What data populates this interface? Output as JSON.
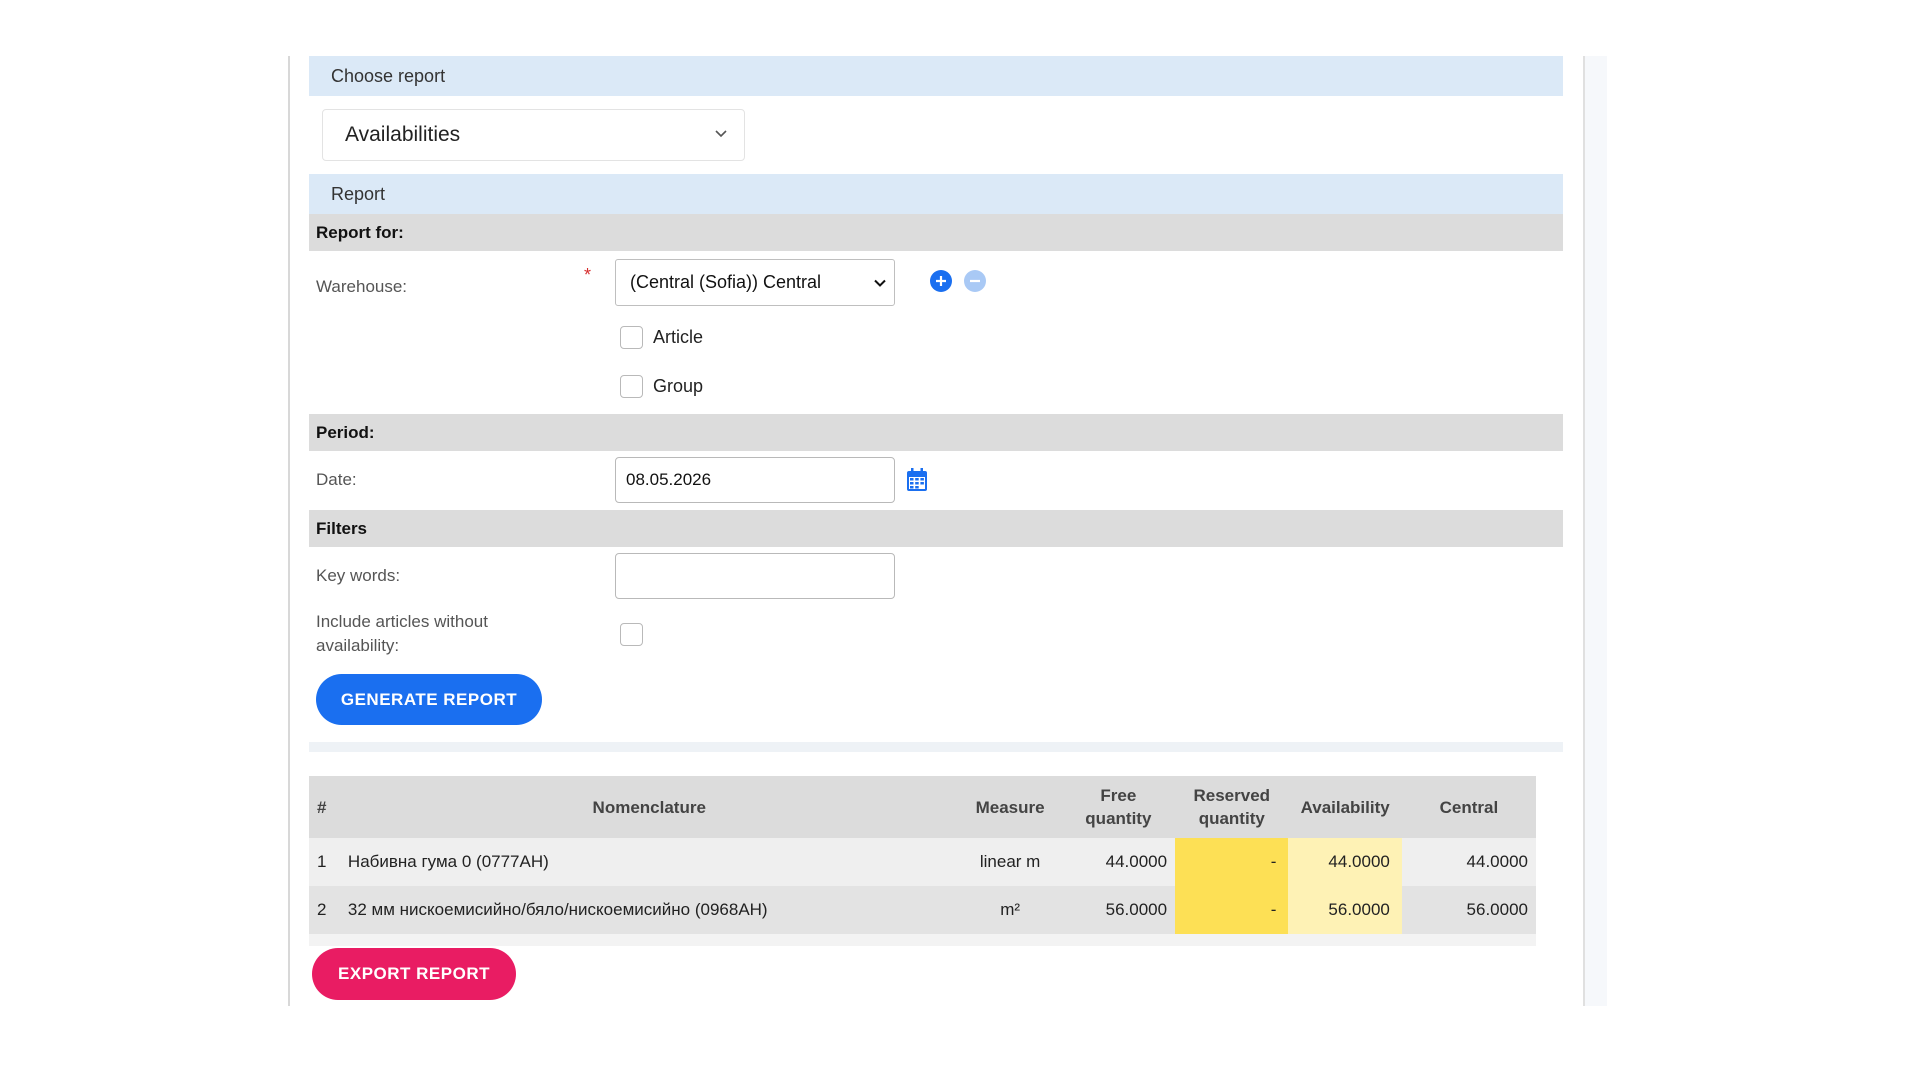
{
  "choose_report": {
    "header": "Choose report",
    "selected": "Availabilities"
  },
  "report": {
    "header": "Report",
    "report_for": {
      "section": "Report for:",
      "warehouse_label": "Warehouse:",
      "required_mark": "*",
      "warehouse_value": "(Central (Sofia)) Central",
      "add_icon": "plus-circle-icon",
      "remove_icon": "minus-circle-icon",
      "article_label": "Article",
      "group_label": "Group"
    },
    "period": {
      "section": "Period:",
      "date_label": "Date:",
      "date_value": "08.05.2026",
      "calendar_icon": "calendar-icon"
    },
    "filters": {
      "section": "Filters",
      "keywords_label": "Key words:",
      "keywords_value": "",
      "include_label": "Include articles without availability:"
    },
    "generate_label": "GENERATE REPORT"
  },
  "results": {
    "columns": {
      "num": "#",
      "nomenclature": "Nomenclature",
      "measure": "Measure",
      "free": "Free quantity",
      "reserved": "Reserved quantity",
      "availability": "Availability",
      "central": "Central"
    },
    "rows": [
      {
        "num": "1",
        "nomenclature": "Набивна гума 0 (0777AH)",
        "measure": "linear m",
        "free": "44.0000",
        "reserved": "-",
        "availability": "44.0000",
        "central": "44.0000"
      },
      {
        "num": "2",
        "nomenclature": "32 мм нискоемисийно/бяло/нискоемисийно (0968AH)",
        "measure": "m²",
        "free": "56.0000",
        "reserved": "-",
        "availability": "56.0000",
        "central": "56.0000"
      }
    ]
  },
  "export_label": "EXPORT REPORT",
  "colors": {
    "primary_blue": "#1a6ff0",
    "export_pink": "#e91c63",
    "reserved_yellow": "#fde055",
    "availability_yellow": "#fef2b5",
    "section_blue": "#dbe9f7"
  }
}
